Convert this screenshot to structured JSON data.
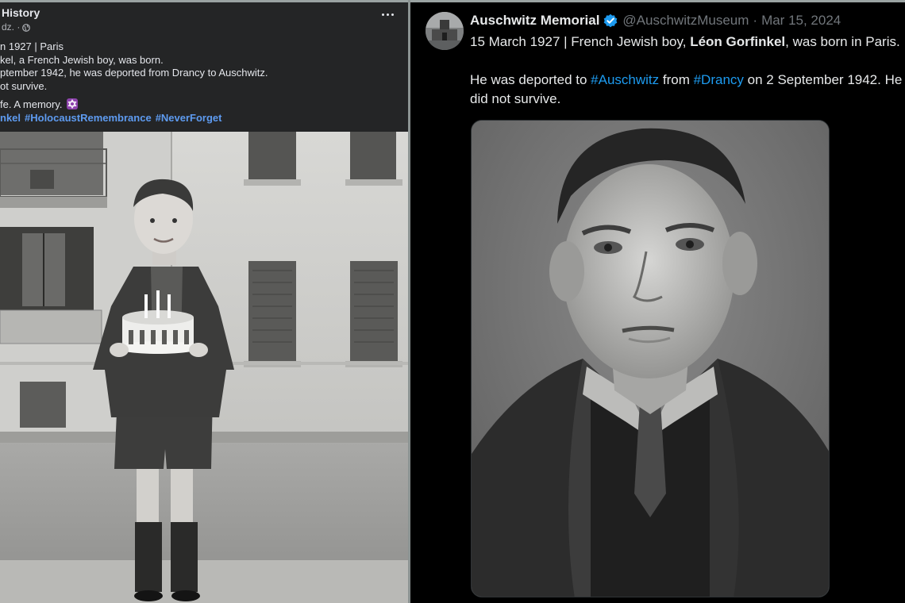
{
  "facebook_post": {
    "page_name": "History",
    "meta": "dz. ·",
    "lines": [
      "n 1927 | Paris",
      "kel, a French Jewish boy, was born.",
      "ptember 1942, he was deported from Drancy to Auschwitz.",
      "ot survive."
    ],
    "closing": "fe. A memory.",
    "hashtags": [
      "nkel",
      "#HolocaustRemembrance",
      "#NeverForget"
    ],
    "icons": {
      "globe": "globe-icon",
      "more": "more-options-icon",
      "emoji": "star-of-david-icon"
    },
    "colors": {
      "background": "#242526",
      "text": "#e4e6eb",
      "link": "#5e9bf0"
    }
  },
  "x_post": {
    "display_name": "Auschwitz Memorial",
    "handle": "@AuschwitzMuseum",
    "separator": "·",
    "date": "Mar 15, 2024",
    "line1_pre": "15 March 1927 | French Jewish boy, ",
    "line1_bold": "Léon Gorfinkel",
    "line1_post": ", was born in Paris.",
    "line2_pre": "He was deported to ",
    "line2_tag1": "#Auschwitz",
    "line2_mid": " from ",
    "line2_tag2": "#Drancy",
    "line2_post": " on 2 September 1942. He",
    "line3": "did not survive.",
    "icons": {
      "verified": "verified-badge-icon"
    },
    "colors": {
      "background": "#000000",
      "text": "#e7e9ea",
      "muted": "#71767b",
      "link": "#1d9bf0",
      "verified": "#1d9bf0"
    }
  }
}
